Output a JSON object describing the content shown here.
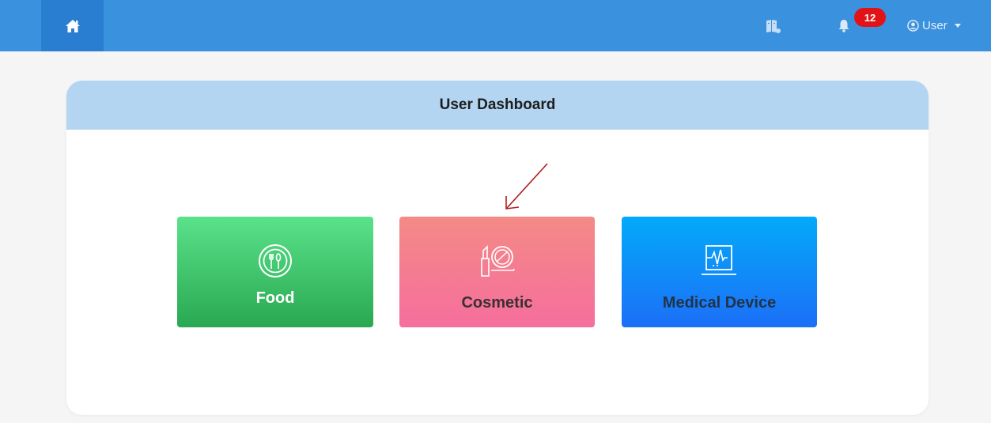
{
  "navbar": {
    "home_icon": "home-icon",
    "book_icon": "book-icon",
    "bell_icon": "bell-icon",
    "notification_count": "12",
    "user_icon": "user-circle-icon",
    "user_label": "User"
  },
  "dashboard": {
    "title": "User Dashboard",
    "tiles": [
      {
        "label": "Food",
        "icon": "food-plate-icon",
        "color_top": "#5ae28a",
        "color_bottom": "#29a851"
      },
      {
        "label": "Cosmetic",
        "icon": "lipstick-compact-icon",
        "color_top": "#f48a86",
        "color_bottom": "#f56e9d"
      },
      {
        "label": "Medical Device",
        "icon": "heart-monitor-icon",
        "color_top": "#03aaf9",
        "color_bottom": "#1c6ff7"
      }
    ]
  },
  "colors": {
    "navbar": "#3a91de",
    "home_button": "#2a7ed1",
    "header_band": "#b3d5f1",
    "badge": "#e21317",
    "annotation_arrow": "#b01c1c"
  }
}
